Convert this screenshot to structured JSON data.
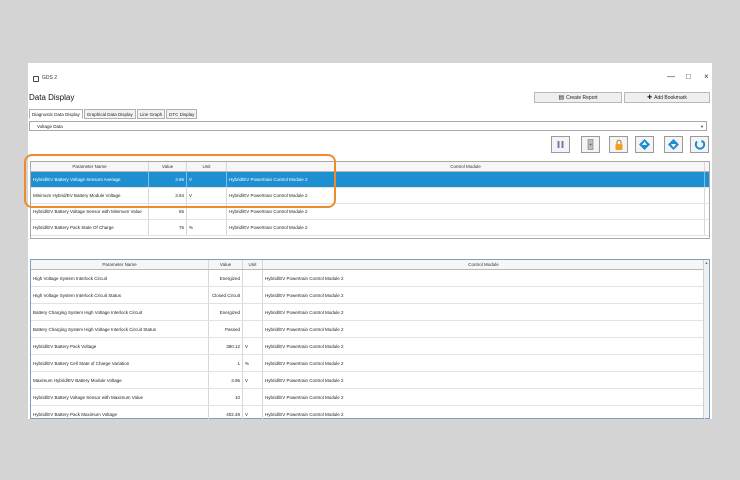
{
  "window": {
    "title": "GDS 2",
    "minimize": "—",
    "maximize": "□",
    "close": "×"
  },
  "page_title": "Data Display",
  "toolbar": {
    "create_report": "Create Report",
    "add_bookmark": "Add Bookmark"
  },
  "tabs": [
    {
      "label": "Diagnostic Data Display"
    },
    {
      "label": "Graphical Data Display"
    },
    {
      "label": "Line Graph"
    },
    {
      "label": "DTC Display"
    }
  ],
  "data_group": {
    "value": "Voltage Data"
  },
  "tool_buttons": [
    {
      "icon": "pause-icon",
      "color": "#6a7fa8"
    },
    {
      "icon": "export-icon",
      "color": "#888888"
    },
    {
      "icon": "lock-icon",
      "color": "#f0a020"
    },
    {
      "icon": "move-up-icon",
      "color": "#1a8fd0"
    },
    {
      "icon": "move-down-icon",
      "color": "#1a8fd0"
    },
    {
      "icon": "refresh-icon",
      "color": "#1a8fd0"
    }
  ],
  "table1": {
    "headers": {
      "name": "Parameter Name",
      "value": "Value",
      "unit": "Unit",
      "module": "Control Module"
    },
    "rows": [
      {
        "name": "Hybrid/EV Battery Voltage Sensors Average",
        "value": "3.96",
        "unit": "V",
        "module": "Hybrid/EV Powertrain Control Module 2",
        "selected": true
      },
      {
        "name": "Minimum Hybrid/EV Battery Module Voltage",
        "value": "3.94",
        "unit": "V",
        "module": "Hybrid/EV Powertrain Control Module 2",
        "selected": false
      },
      {
        "name": "Hybrid/EV Battery Voltage Sensor with Minimum Value",
        "value": "65",
        "unit": "",
        "module": "Hybrid/EV Powertrain Control Module 2",
        "selected": false
      },
      {
        "name": "Hybrid/EV Battery Pack State Of Charge",
        "value": "76",
        "unit": "%",
        "module": "Hybrid/EV Powertrain Control Module 2",
        "selected": false
      }
    ]
  },
  "table2": {
    "headers": {
      "name": "Parameter Name",
      "value": "Value",
      "unit": "Unit",
      "module": "Control Module"
    },
    "rows": [
      {
        "name": "High Voltage System Interlock Circuit",
        "value": "Energized",
        "unit": "",
        "module": "Hybrid/EV Powertrain Control Module 2"
      },
      {
        "name": "High Voltage System Interlock Circuit Status",
        "value": "Closed Circuit",
        "unit": "",
        "module": "Hybrid/EV Powertrain Control Module 2"
      },
      {
        "name": "Battery Charging System High Voltage Interlock Circuit",
        "value": "Energized",
        "unit": "",
        "module": "Hybrid/EV Powertrain Control Module 2"
      },
      {
        "name": "Battery Charging System High Voltage Interlock Circuit Status",
        "value": "Passed",
        "unit": "",
        "module": "Hybrid/EV Powertrain Control Module 2"
      },
      {
        "name": "Hybrid/EV Battery Pack Voltage",
        "value": "380.12",
        "unit": "V",
        "module": "Hybrid/EV Powertrain Control Module 2"
      },
      {
        "name": "Hybrid/EV Battery Cell State of Charge Variation",
        "value": "1",
        "unit": "%",
        "module": "Hybrid/EV Powertrain Control Module 2"
      },
      {
        "name": "Maximum Hybrid/EV Battery Module Voltage",
        "value": "3.96",
        "unit": "V",
        "module": "Hybrid/EV Powertrain Control Module 2"
      },
      {
        "name": "Hybrid/EV Battery Voltage Sensor with Maximum Value",
        "value": "10",
        "unit": "",
        "module": "Hybrid/EV Powertrain Control Module 2"
      },
      {
        "name": "Hybrid/EV Battery Pack Maximum Voltage",
        "value": "402.48",
        "unit": "V",
        "module": "Hybrid/EV Powertrain Control Module 2"
      }
    ]
  },
  "colors": {
    "selection": "#1e8fd0",
    "highlight_outline": "#ef8a2d"
  }
}
